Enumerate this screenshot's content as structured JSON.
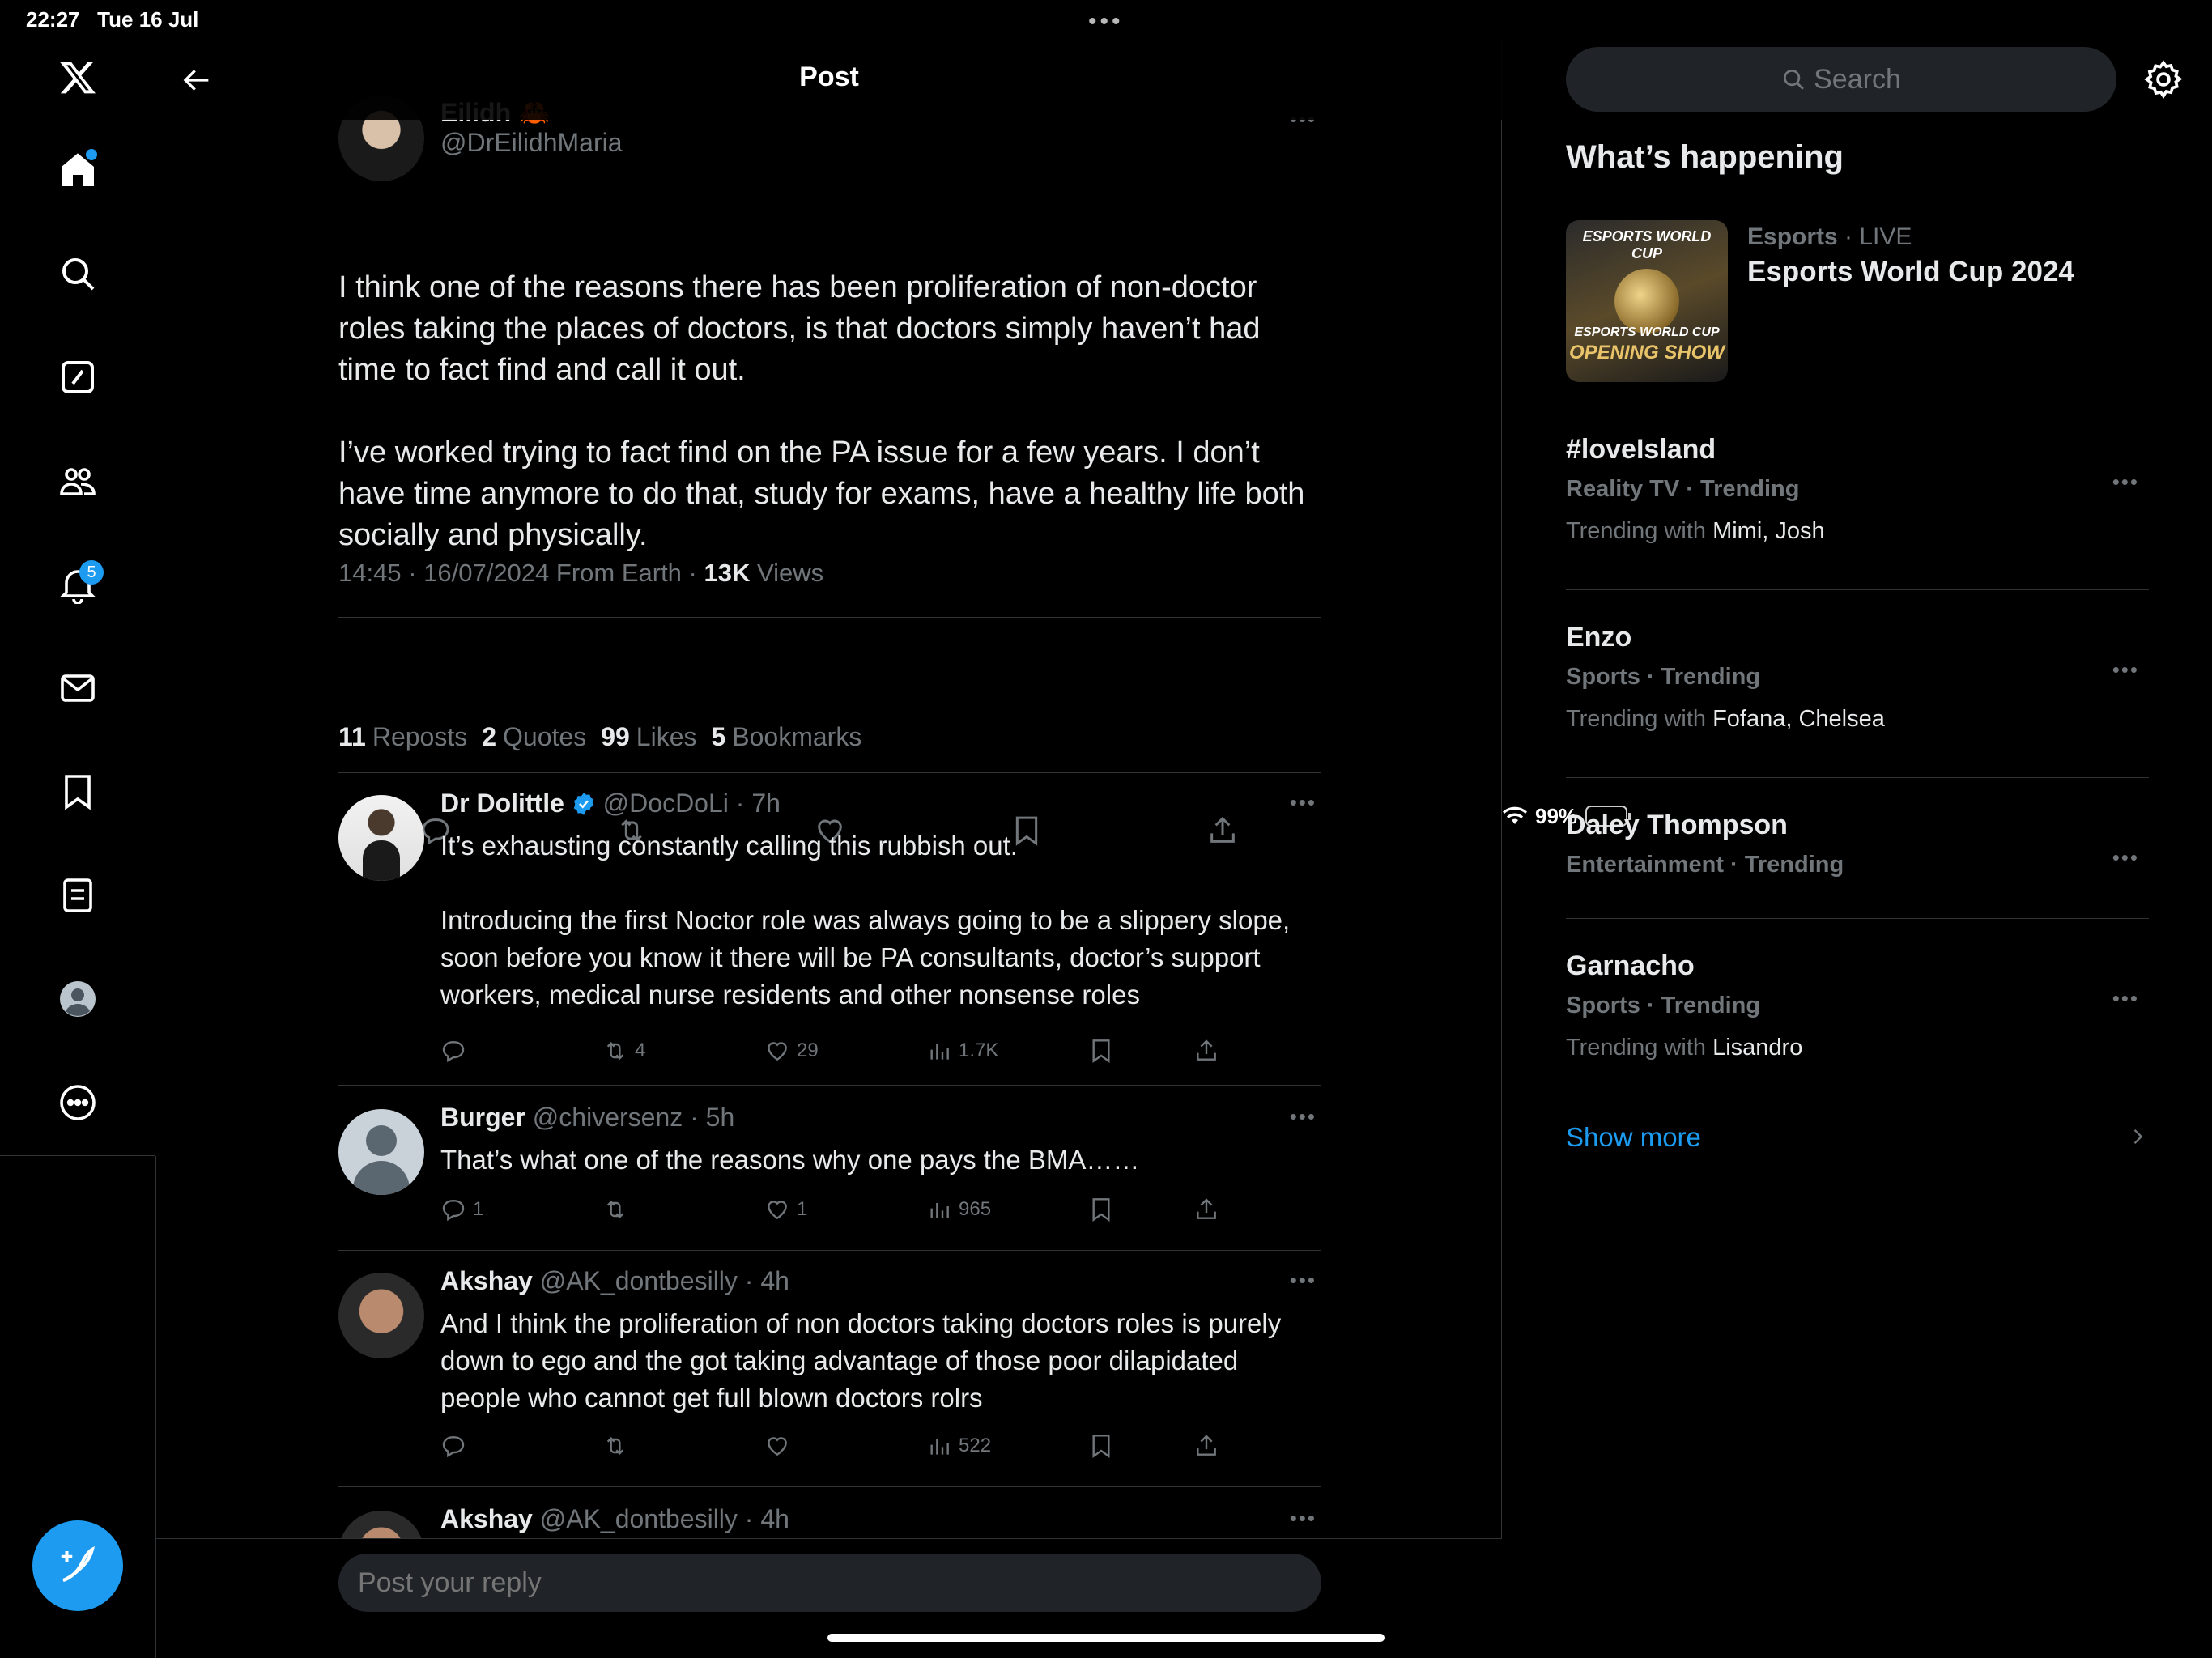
{
  "status_bar": {
    "time": "22:27",
    "date": "Tue 16 Jul",
    "battery": "99%"
  },
  "nav": {
    "items": [
      {
        "name": "x-logo"
      },
      {
        "name": "home"
      },
      {
        "name": "search"
      },
      {
        "name": "grok"
      },
      {
        "name": "communities"
      },
      {
        "name": "notifications",
        "badge": "5"
      },
      {
        "name": "messages"
      },
      {
        "name": "bookmarks"
      },
      {
        "name": "lists"
      },
      {
        "name": "profile"
      },
      {
        "name": "more"
      }
    ]
  },
  "header": {
    "title": "Post"
  },
  "post": {
    "author_name": "Eilidh 🦀",
    "author_handle": "@DrEilidhMaria",
    "text": "I think one of the reasons there has been proliferation of non-doctor roles taking the places of doctors, is that doctors simply haven’t had time to fact find and call it out.\n\nI’ve worked trying to fact find on the PA issue for a few years. I don’t have time anymore to do that, study for exams, have a healthy life both socially and physically.",
    "meta": "14:45 · 16/07/2024 From Earth · ",
    "views_count": "13K",
    "views_label": "Views",
    "stats": {
      "reposts_count": "11",
      "reposts_label": "Reposts",
      "quotes_count": "2",
      "quotes_label": "Quotes",
      "likes_count": "99",
      "likes_label": "Likes",
      "bookmarks_count": "5",
      "bookmarks_label": "Bookmarks"
    }
  },
  "replies": [
    {
      "name": "Dr Dolittle",
      "handle": "@DocDoLi · 7h",
      "text": "It’s exhausting constantly calling this rubbish out.\n\nIntroducing the first Noctor role was always going to be a slippery slope, soon before you know it there will be PA consultants, doctor’s support workers, medical nurse residents and other nonsense roles",
      "replies": "",
      "reposts": "4",
      "likes": "29",
      "views": "1.7K"
    },
    {
      "name": "Burger",
      "handle": "@chiversenz · 5h",
      "text": "That’s  what  one of the reasons why one pays the BMA……",
      "replies": "1",
      "reposts": "",
      "likes": "1",
      "views": "965"
    },
    {
      "name": "Akshay",
      "handle": "@AK_dontbesilly · 4h",
      "text": "And I think the proliferation of non doctors taking doctors roles is purely down to ego and the got taking advantage of those poor dilapidated people who cannot get full blown doctors rolrs",
      "replies": "",
      "reposts": "",
      "likes": "",
      "views": "522"
    },
    {
      "name": "Akshay",
      "handle": "@AK_dontbesilly · 4h"
    }
  ],
  "reply_box": {
    "placeholder": "Post your reply"
  },
  "sidebar": {
    "search_placeholder": "Search",
    "section_title": "What’s happening",
    "featured": {
      "category": "Esports",
      "live": " · LIVE",
      "title": "Esports World Cup 2024",
      "thumb_top": "ESPORTS WORLD CUP",
      "thumb_mid": "ESPORTS WORLD CUP",
      "thumb_bottom": "OPENING SHOW"
    },
    "trends": [
      {
        "name": "#loveIsland",
        "category": "Reality TV · Trending",
        "with_label": "Trending with ",
        "with": "Mimi, Josh"
      },
      {
        "name": "Enzo",
        "category": "Sports · Trending",
        "with_label": "Trending with ",
        "with": "Fofana, Chelsea"
      },
      {
        "name": "Daley Thompson",
        "category": "Entertainment · Trending",
        "with_label": "",
        "with": ""
      },
      {
        "name": "Garnacho",
        "category": "Sports · Trending",
        "with_label": "Trending with ",
        "with": "Lisandro"
      }
    ],
    "show_more": "Show more"
  },
  "colors": {
    "accent": "#1d9bf0",
    "muted": "#71767b",
    "divider": "#2f3336",
    "background": "#000000"
  }
}
